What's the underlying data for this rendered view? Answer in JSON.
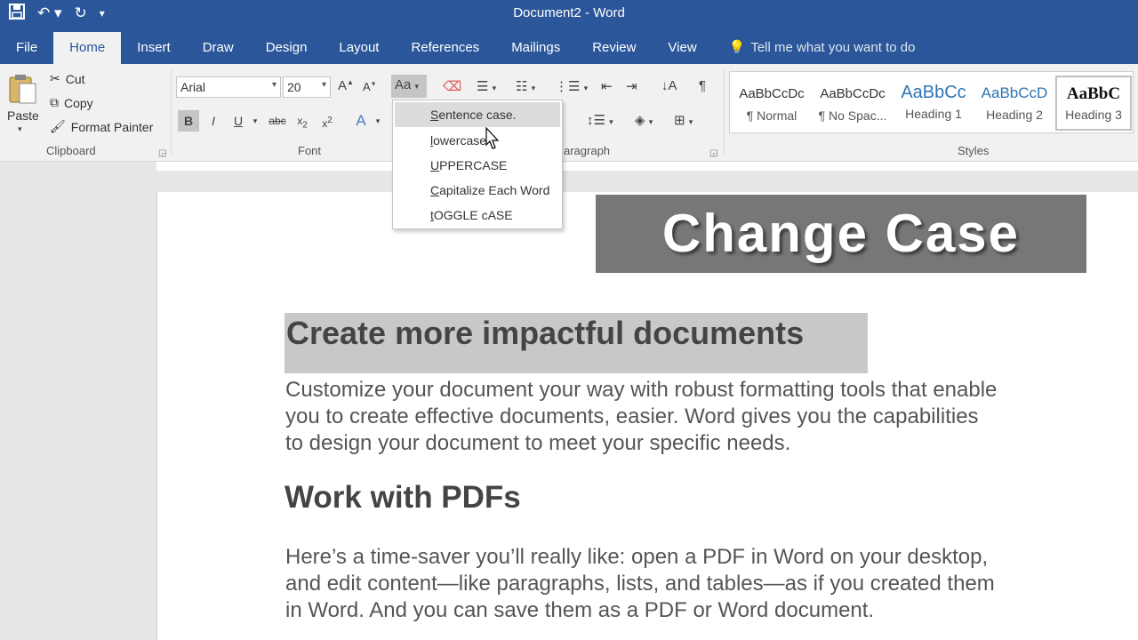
{
  "app": {
    "window_title": "Document2  -  Word"
  },
  "qat": {
    "save_icon": "save-icon",
    "undo_icon": "undo-icon",
    "redo_icon": "redo-icon",
    "customize_icon": "customize-qat-icon"
  },
  "tabs": [
    {
      "label": "File"
    },
    {
      "label": "Home"
    },
    {
      "label": "Insert"
    },
    {
      "label": "Draw"
    },
    {
      "label": "Design"
    },
    {
      "label": "Layout"
    },
    {
      "label": "References"
    },
    {
      "label": "Mailings"
    },
    {
      "label": "Review"
    },
    {
      "label": "View"
    }
  ],
  "tell_me": {
    "placeholder": "Tell me what you want to do"
  },
  "clipboard": {
    "paste_label": "Paste",
    "cut_label": "Cut",
    "copy_label": "Copy",
    "format_painter_label": "Format Painter",
    "group_label": "Clipboard"
  },
  "font": {
    "family": "Arial",
    "size": "20",
    "group_label": "Font",
    "bold": "B",
    "italic": "I",
    "underline": "U",
    "strike": "abc",
    "change_case": "Aa"
  },
  "paragraph": {
    "group_label": "aragraph"
  },
  "styles": {
    "group_label": "Styles",
    "items": [
      {
        "preview": "AaBbCcDc",
        "name": "¶ Normal"
      },
      {
        "preview": "AaBbCcDc",
        "name": "¶ No Spac..."
      },
      {
        "preview": "AaBbCc",
        "name": "Heading 1"
      },
      {
        "preview": "AaBbCcD",
        "name": "Heading 2"
      },
      {
        "preview": "AaBbC",
        "name": "Heading 3"
      }
    ]
  },
  "change_case_menu": [
    {
      "key": "S",
      "rest": "entence case."
    },
    {
      "key": "l",
      "rest": "owercase"
    },
    {
      "key": "U",
      "rest": "PPERCASE"
    },
    {
      "key": "C",
      "rest": "apitalize Each Word"
    },
    {
      "key": "t",
      "rest": "OGGLE cASE"
    }
  ],
  "banner": {
    "text": "Change Case"
  },
  "document": {
    "heading1": "Create more impactful documents",
    "para1": [
      "Customize your document your way with robust formatting tools that enable",
      "you to create effective documents, easier. Word gives you the capabilities",
      "to design your document to meet your specific needs."
    ],
    "heading2": "Work with PDFs",
    "para2": [
      "Here’s a time-saver you’ll really like: open a PDF in Word on your desktop,",
      "and edit content—like paragraphs, lists, and tables—as if you created them",
      "in Word. And you can save them as a PDF or Word document."
    ]
  },
  "colors": {
    "accent": "#2b579a",
    "ribbon": "#f1f1f1",
    "highlight": "#c8c8c8",
    "banner": "#777777"
  }
}
